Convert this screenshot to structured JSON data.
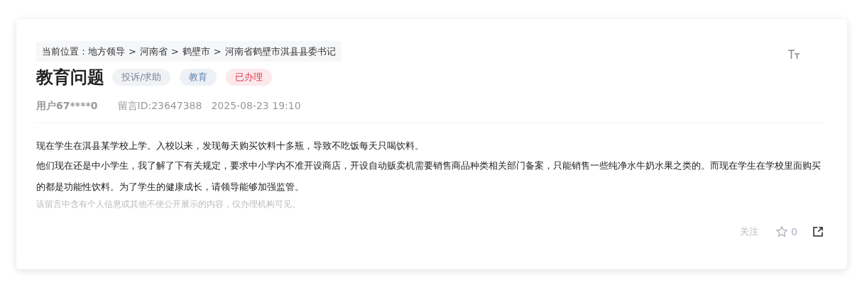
{
  "breadcrumb": {
    "label": "当前位置：",
    "items": [
      "地方领导",
      "河南省",
      "鹤壁市",
      "河南省鹤壁市淇县县委书记"
    ],
    "separator": ">"
  },
  "title": "教育问题",
  "tags": [
    {
      "label": "投诉/求助",
      "color": "#7a8599"
    },
    {
      "label": "教育",
      "color": "#5b7fb0"
    },
    {
      "label": "已办理",
      "color": "#e0384f"
    }
  ],
  "meta": {
    "user": "用户67****0",
    "message_id": "留言ID:23647388",
    "time": "2025-08-23 19:10"
  },
  "paragraphs": [
    "现在学生在淇县某学校上学。入校以来，发现每天购买饮料十多瓶，导致不吃饭每天只喝饮料。",
    "他们现在还是中小学生，我了解了下有关规定，要求中小学内不准开设商店，开设自动贩卖机需要销售商品种类相关部门备案，只能销售一些纯净水牛奶水果之类的。而现在学生在学校里面购买的都是功能性饮料。为了学生的健康成长，请领导能够加强监管。"
  ],
  "notice": "该留言中含有个人信息或其他不便公开展示的内容，仅办理机构可见。",
  "actions": {
    "follow": "关注",
    "stars_count": "0"
  }
}
